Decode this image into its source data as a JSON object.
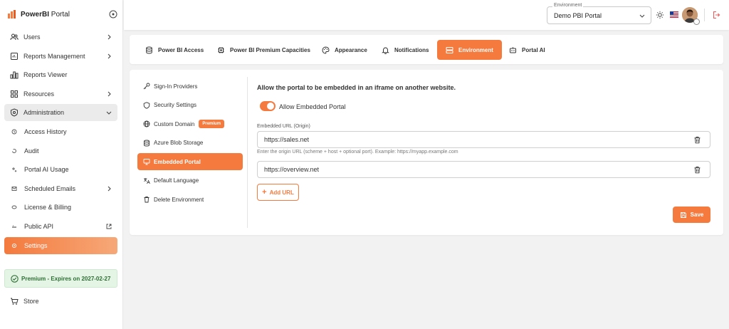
{
  "app": {
    "brand_bold": "PowerBI",
    "brand_rest": " Portal"
  },
  "sidebar": {
    "items": [
      {
        "label": "Users",
        "icon": "users-icon"
      },
      {
        "label": "Reports Management",
        "icon": "reports-management-icon"
      },
      {
        "label": "Reports Viewer",
        "icon": "bar-chart-icon"
      },
      {
        "label": "Resources",
        "icon": "grid-icon"
      },
      {
        "label": "Administration",
        "icon": "shield-gear-icon"
      },
      {
        "label": "Access History",
        "icon": "history-icon"
      },
      {
        "label": "Audit",
        "icon": "audit-icon"
      },
      {
        "label": "Portal AI Usage",
        "icon": "sparkle-icon"
      },
      {
        "label": "Scheduled Emails",
        "icon": "mail-icon"
      },
      {
        "label": "License & Billing",
        "icon": "billing-icon"
      },
      {
        "label": "Public API",
        "icon": "api-icon"
      },
      {
        "label": "Settings",
        "icon": "settings-icon"
      }
    ],
    "premium": "Premium - Expires on 2027-02-27",
    "store": "Store"
  },
  "header": {
    "environment_legend": "Environment",
    "environment_value": "Demo PBI Portal"
  },
  "tabs": [
    {
      "label": "Power BI Access",
      "icon": "database-icon"
    },
    {
      "label": "Power BI Premium Capacities",
      "icon": "chip-icon"
    },
    {
      "label": "Appearance",
      "icon": "palette-icon"
    },
    {
      "label": "Notifications",
      "icon": "bell-icon"
    },
    {
      "label": "Environment",
      "icon": "server-icon"
    },
    {
      "label": "Portal AI",
      "icon": "robot-icon"
    }
  ],
  "settings_nav": {
    "items": [
      {
        "label": "Sign-In Providers"
      },
      {
        "label": "Security Settings"
      },
      {
        "label": "Custom Domain",
        "badge": "Premium"
      },
      {
        "label": "Azure Blob Storage"
      },
      {
        "label": "Embedded Portal"
      },
      {
        "label": "Default Language"
      },
      {
        "label": "Delete Environment"
      }
    ]
  },
  "embedded": {
    "description": "Allow the portal to be embedded in an iframe on another website.",
    "toggle_label": "Allow Embedded Portal",
    "toggle_on": true,
    "field_label": "Embedded URL (Origin)",
    "urls": [
      "https://sales.net",
      "https://overview.net"
    ],
    "hint": "Enter the origin URL (scheme + host + optional port). Example: https://myapp.example.com",
    "add_url": "Add URL",
    "save": "Save"
  },
  "colors": {
    "accent": "#f47a3e",
    "premium_bg": "#e4f5e6",
    "premium_text": "#2f6e34"
  }
}
